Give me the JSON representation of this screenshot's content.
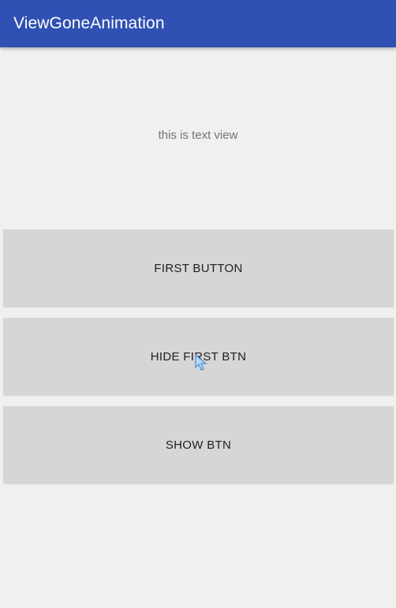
{
  "app_bar": {
    "title": "ViewGoneAnimation",
    "color": "#3051b3"
  },
  "content": {
    "text_view": "this is text view",
    "buttons": [
      {
        "label": "FIRST BUTTON"
      },
      {
        "label": "HIDE FIRST BTN"
      },
      {
        "label": "SHOW BTN"
      }
    ]
  },
  "cursor": {
    "icon": "pointer-cursor-icon"
  }
}
